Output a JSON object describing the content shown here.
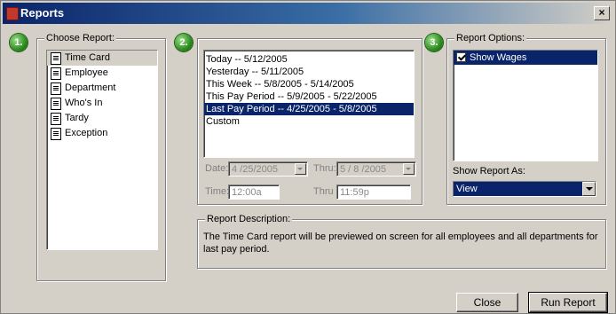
{
  "window": {
    "title": "Reports",
    "close_label": "×"
  },
  "step1": {
    "badge": "1.",
    "label": "Choose Report:",
    "reports": [
      "Time Card",
      "Employee",
      "Department",
      "Who's In",
      "Tardy",
      "Exception"
    ]
  },
  "step2": {
    "badge": "2.",
    "periods": [
      "Today -- 5/12/2005",
      "Yesterday -- 5/11/2005",
      "This Week -- 5/8/2005 - 5/14/2005",
      "This Pay Period -- 5/9/2005 - 5/22/2005",
      "Last Pay Period -- 4/25/2005 - 5/8/2005",
      "Custom"
    ],
    "date_label": "Date:",
    "date_value": "4 /25/2005",
    "thru_label": "Thru:",
    "thru_value": "5 / 8 /2005",
    "time_label": "Time:",
    "time_value": "12:00a",
    "thru_time_label": "Thru",
    "thru_time_value": "11:59p"
  },
  "step3": {
    "badge": "3.",
    "label": "Report Options:",
    "option": "Show Wages",
    "show_as_label": "Show Report As:",
    "show_as_value": "View"
  },
  "description": {
    "label": "Report Description:",
    "text": "The Time Card report will be previewed on screen for all employees and all departments for last pay period."
  },
  "buttons": {
    "close": "Close",
    "run": "Run Report"
  }
}
